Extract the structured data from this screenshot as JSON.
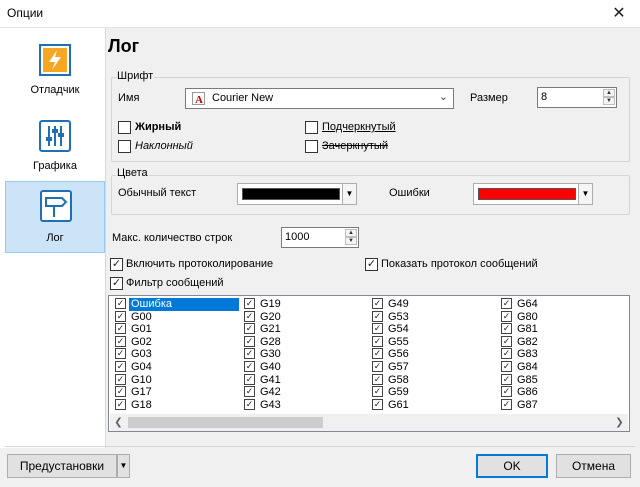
{
  "window": {
    "title": "Опции",
    "close_glyph": "✕"
  },
  "sidebar": {
    "items": [
      {
        "label": "Отладчик",
        "icon": "lightning-icon",
        "selected": false
      },
      {
        "label": "Графика",
        "icon": "sliders-icon",
        "selected": false
      },
      {
        "label": "Лог",
        "icon": "signpost-icon",
        "selected": true
      }
    ]
  },
  "page": {
    "title": "Лог"
  },
  "font_group": {
    "legend": "Шрифт",
    "name_label": "Имя",
    "name_value": "Courier New",
    "size_label": "Размер",
    "size_value": "8",
    "bold_label": "Жирный",
    "italic_label": "Наклонный",
    "underline_label": "Подчеркнутый",
    "strikeout_label": "Зачеркнутый"
  },
  "colors_group": {
    "legend": "Цвета",
    "normal_label": "Обычный текст",
    "normal_color": "#000000",
    "errors_label": "Ошибки",
    "errors_color": "#ff0000"
  },
  "max_lines": {
    "label": "Макс. количество строк",
    "value": "1000"
  },
  "options": {
    "enable_logging": "Включить протоколирование",
    "show_message_log": "Показать протокол сообщений",
    "message_filter": "Фильтр сообщений"
  },
  "filter_list": {
    "columns": [
      [
        "Ошибка",
        "G00",
        "G01",
        "G02",
        "G03",
        "G04",
        "G10",
        "G17",
        "G18"
      ],
      [
        "G19",
        "G20",
        "G21",
        "G28",
        "G30",
        "G40",
        "G41",
        "G42",
        "G43"
      ],
      [
        "G49",
        "G53",
        "G54",
        "G55",
        "G56",
        "G57",
        "G58",
        "G59",
        "G61"
      ],
      [
        "G64",
        "G80",
        "G81",
        "G82",
        "G83",
        "G84",
        "G85",
        "G86",
        "G87"
      ]
    ],
    "check_glyph": "✓"
  },
  "footer": {
    "presets_label": "Предустановки",
    "ok_label": "OK",
    "cancel_label": "Отмена"
  },
  "colors": {
    "accent": "#0078d7",
    "selection_bg": "#cce4f7",
    "icon_blue": "#1f6fb5",
    "icon_orange": "#f5a623"
  }
}
